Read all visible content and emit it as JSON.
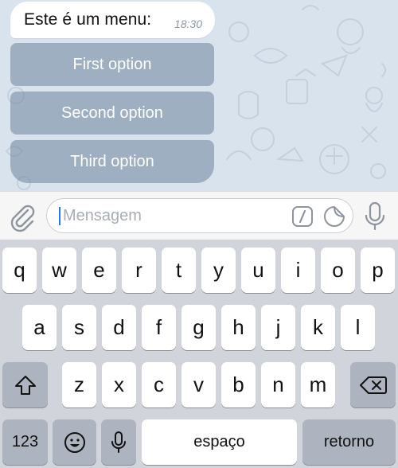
{
  "chat": {
    "message_text": "Este é um menu:",
    "message_time": "18:30",
    "options": [
      "First option",
      "Second option",
      "Third option"
    ]
  },
  "input": {
    "placeholder": "Mensagem",
    "attach_icon": "paperclip-icon",
    "commands_icon": "slash-command-icon",
    "sticker_icon": "sticker-icon",
    "mic_icon": "microphone-icon"
  },
  "keyboard": {
    "row1": [
      "q",
      "w",
      "e",
      "r",
      "t",
      "y",
      "u",
      "i",
      "o",
      "p"
    ],
    "row2": [
      "a",
      "s",
      "d",
      "f",
      "g",
      "h",
      "j",
      "k",
      "l"
    ],
    "row3": [
      "z",
      "x",
      "c",
      "v",
      "b",
      "n",
      "m"
    ],
    "shift_icon": "shift-icon",
    "backspace_icon": "backspace-icon",
    "numbers_label": "123",
    "emoji_icon": "emoji-icon",
    "dictation_icon": "microphone-icon",
    "space_label": "espaço",
    "return_label": "retorno"
  },
  "colors": {
    "chat_background": "#d9e3ee",
    "option_button": "#7489a1",
    "caret": "#1e7bf2",
    "keyboard_background": "#d1d4db",
    "function_key": "#adb4bf"
  }
}
